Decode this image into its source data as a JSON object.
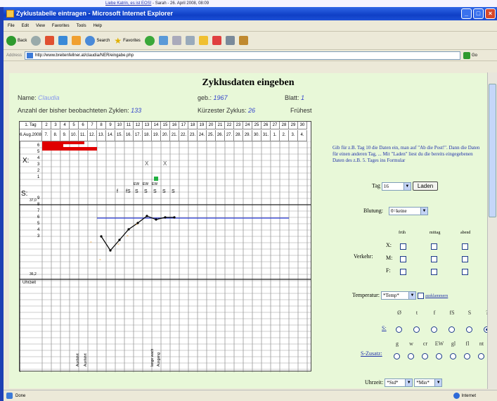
{
  "top_strip": {
    "link": "Liebe Katrin, es ist EOS!",
    "rest": " - Sarah - 26. April 2008, 08:09"
  },
  "window": {
    "title": "Zyklustabelle eintragen - Microsoft Internet Explorer"
  },
  "menu": [
    "File",
    "Edit",
    "View",
    "Favorites",
    "Tools",
    "Help"
  ],
  "toolbar": {
    "back": "Back",
    "search": "Search",
    "favorites": "Favorites"
  },
  "address": {
    "label": "Address",
    "url": "http://www.breitenfellner.at/claudia/NER/eingabe.php",
    "go": "Go"
  },
  "page": {
    "title": "Zyklusdaten eingeben",
    "name_label": "Name:",
    "geb_label": "geb.:",
    "geb_value": "1967",
    "blatt_label": "Blatt:",
    "blatt_value": "1",
    "cycles_label": "Anzahl der bisher beobachteten Zyklen:",
    "cycles_value": "133",
    "shortest_label": "Kürzester Zyklus:",
    "shortest_value": "26",
    "earliest_label": "Frühest"
  },
  "table": {
    "tag_label": "1. Tag",
    "days": [
      "2",
      "3",
      "4",
      "5",
      "6",
      "7",
      "8",
      "9",
      "10",
      "11",
      "12",
      "13",
      "14",
      "15",
      "16",
      "17",
      "18",
      "19",
      "20",
      "21",
      "22",
      "23",
      "24",
      "25",
      "26",
      "27",
      "28",
      "29",
      "30"
    ],
    "date_label": "6.Aug.2008",
    "dates": [
      "7.",
      "8.",
      "9.",
      "10.",
      "11.",
      "12.",
      "13.",
      "14.",
      "15.",
      "16.",
      "17.",
      "18.",
      "19.",
      "20.",
      "21.",
      "22.",
      "23.",
      "24.",
      "25.",
      "26.",
      "27.",
      "28.",
      "29.",
      "30.",
      "31.",
      "1.",
      "2.",
      "3.",
      "4."
    ],
    "row_x": "X:",
    "row_s": "S:",
    "temp_top": "37,0",
    "temp_bot": "36,2",
    "uhrzeit": "Uhrzeit",
    "left_scale": [
      "6",
      "5",
      "4",
      "3",
      "2",
      "1",
      "",
      "9",
      "8",
      "7",
      "6",
      "5",
      "4",
      "3"
    ],
    "s_marks": [
      "EW",
      "EW",
      "EW"
    ],
    "bottom_text": [
      "Ausfahrt",
      "Ausfahrt",
      "lange wach",
      "Ausgang"
    ]
  },
  "form": {
    "help": "Gib für z.B. Tag 10 die Daten ein, man auf \"Ab die Post!\". Dann die Daten für einen anderen Tag, ... Mit \"Laden\" liest du die bereits eingegebenen Daten des z.B. 5. Tages ins Formular",
    "tag_label": "Tag",
    "tag_value": "16",
    "load": "Laden",
    "bleed_label": "Blutung:",
    "bleed_value": "0=keine",
    "col_frueh": "früh",
    "col_mittag": "mittag",
    "col_abend": "abend",
    "verkehr_label": "Verkehr:",
    "rows": [
      "X:",
      "M:",
      "F:"
    ],
    "temp_label": "Temperatur:",
    "temp_value": "*Temp*",
    "temp_link": "ausklammern",
    "s_label": "S:",
    "s_syms": [
      "Ø",
      "t",
      "f",
      "fS",
      "S",
      "?"
    ],
    "sz_label": "S-Zusatz:",
    "sz_syms": [
      "g",
      "w",
      "cr",
      "EW",
      "gl",
      "fl",
      "nt"
    ],
    "time_label": "Uhrzeit:",
    "time_h": "*Std*",
    "time_m": "*Min*"
  },
  "status": {
    "left": "Done",
    "right": "Internet"
  }
}
